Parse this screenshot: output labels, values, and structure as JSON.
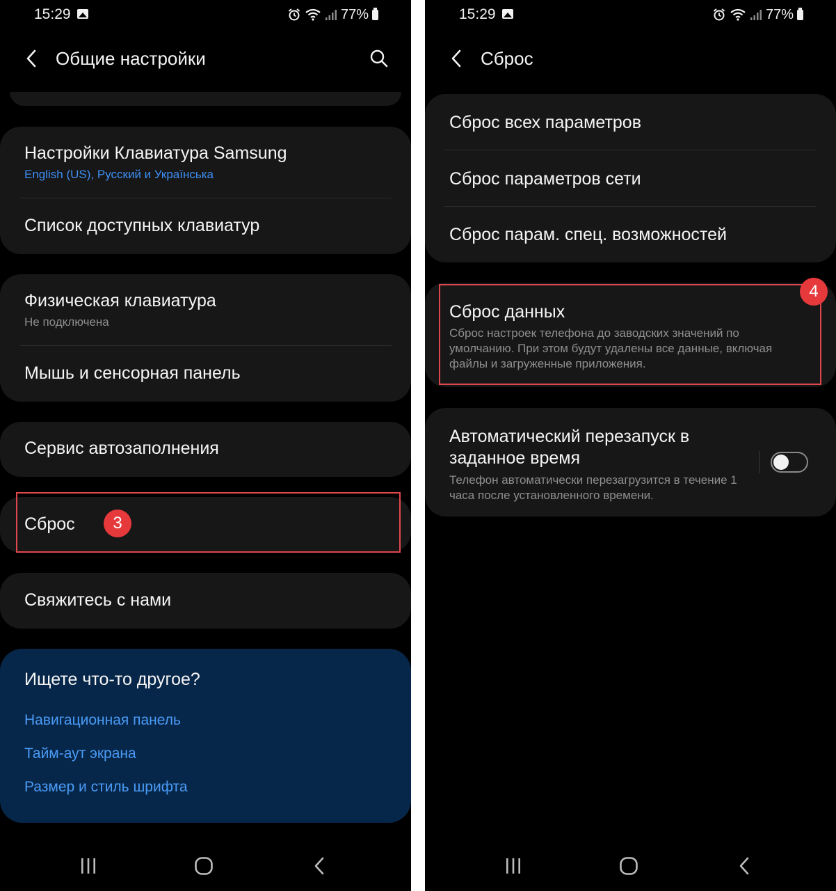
{
  "status": {
    "time": "15:29",
    "battery": "77%"
  },
  "left": {
    "header_title": "Общие настройки",
    "keyboard_settings": {
      "title": "Настройки Клавиатура Samsung",
      "subtitle": "English (US), Русский и Українська"
    },
    "keyboard_list": {
      "title": "Список доступных клавиатур"
    },
    "physical_keyboard": {
      "title": "Физическая клавиатура",
      "subtitle": "Не подключена"
    },
    "mouse_touchpad": {
      "title": "Мышь и сенсорная панель"
    },
    "autofill": {
      "title": "Сервис автозаполнения"
    },
    "reset": {
      "title": "Сброс",
      "badge": "3"
    },
    "contact": {
      "title": "Свяжитесь с нами"
    },
    "suggestions": {
      "title": "Ищете что-то другое?",
      "links": [
        "Навигационная панель",
        "Тайм-аут экрана",
        "Размер и стиль шрифта"
      ]
    }
  },
  "right": {
    "header_title": "Сброс",
    "items": [
      "Сброс всех параметров",
      "Сброс параметров сети",
      "Сброс парам. спец. возможностей"
    ],
    "factory_reset": {
      "title": "Сброс данных",
      "description": "Сброс настроек телефона до заводских значений по умолчанию. При этом будут удалены все данные, включая файлы и загруженные приложения.",
      "badge": "4"
    },
    "auto_restart": {
      "title": "Автоматический перезапуск в заданное время",
      "description": "Телефон автоматически перезагрузится в течение 1 часа после установленного времени.",
      "enabled": false
    }
  },
  "icons": {
    "back": "chevron-left-icon",
    "search": "search-icon",
    "gallery": "image-icon",
    "alarm": "alarm-icon",
    "wifi": "wifi-icon",
    "signal": "signal-icon",
    "battery": "battery-icon",
    "nav_recents": "recents-icon",
    "nav_home": "home-icon",
    "nav_back": "back-icon"
  },
  "colors": {
    "background": "#000000",
    "card": "#171717",
    "link_blue": "#3e8ff5",
    "suggest_bg": "#07274a",
    "highlight_red": "#e0474c"
  }
}
